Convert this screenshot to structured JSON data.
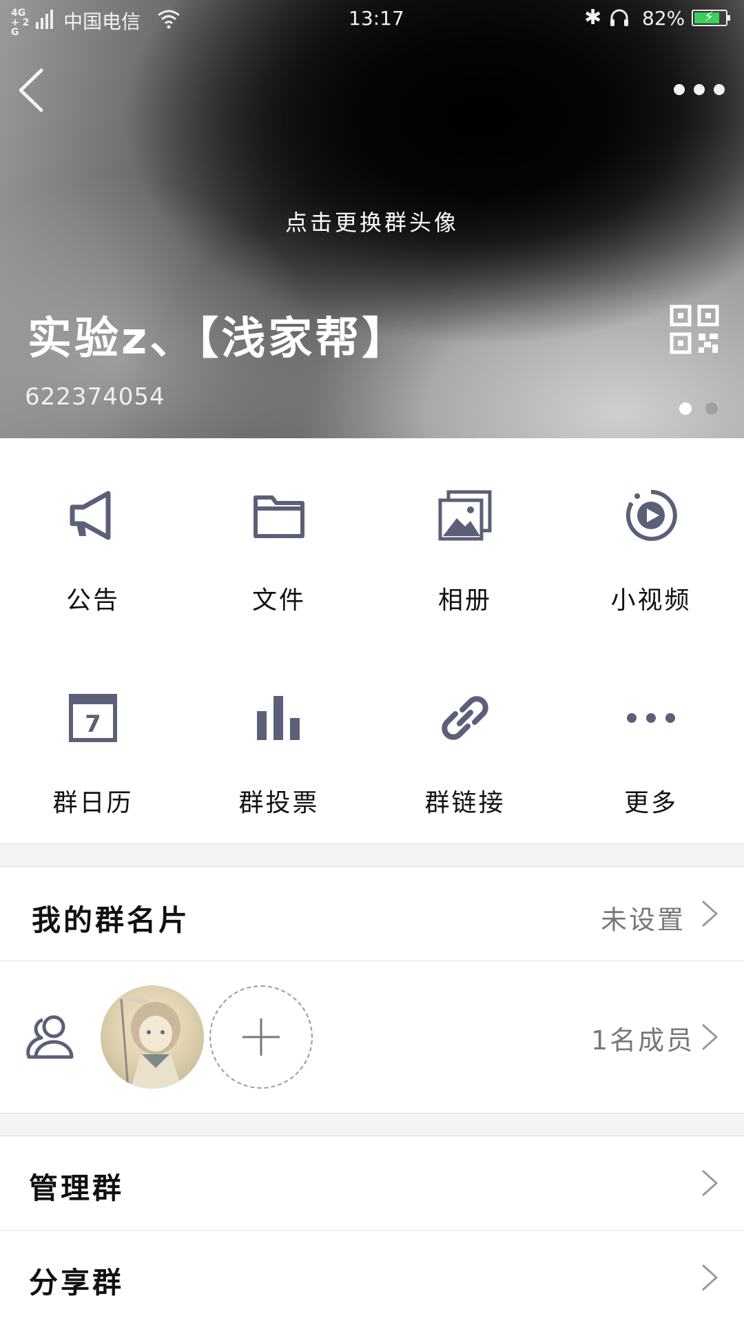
{
  "status_bar": {
    "network": "4G+ 2G",
    "carrier": "中国电信",
    "time": "13:17",
    "battery_percent": "82%",
    "battery_level": 0.82,
    "battery_color": "#3ccf5a"
  },
  "header": {
    "change_avatar_label": "点击更换群头像",
    "group_name": "实验z、【浅家帮】",
    "group_id": "622374054",
    "page_index": 0,
    "page_count": 2
  },
  "features": [
    {
      "label": "公告",
      "icon": "megaphone-icon"
    },
    {
      "label": "文件",
      "icon": "folder-icon"
    },
    {
      "label": "相册",
      "icon": "album-icon"
    },
    {
      "label": "小视频",
      "icon": "video-icon"
    },
    {
      "label": "群日历",
      "icon": "calendar-icon"
    },
    {
      "label": "群投票",
      "icon": "vote-icon"
    },
    {
      "label": "群链接",
      "icon": "link-icon"
    },
    {
      "label": "更多",
      "icon": "more-icon"
    }
  ],
  "calendar_day": "7",
  "group_card": {
    "label": "我的群名片",
    "value": "未设置"
  },
  "members": {
    "count_label": "1名成员"
  },
  "manage_group": {
    "label": "管理群"
  },
  "share_group": {
    "label": "分享群"
  },
  "colors": {
    "icon": "#5b6078",
    "text": "#111111",
    "secondary": "#777777"
  }
}
